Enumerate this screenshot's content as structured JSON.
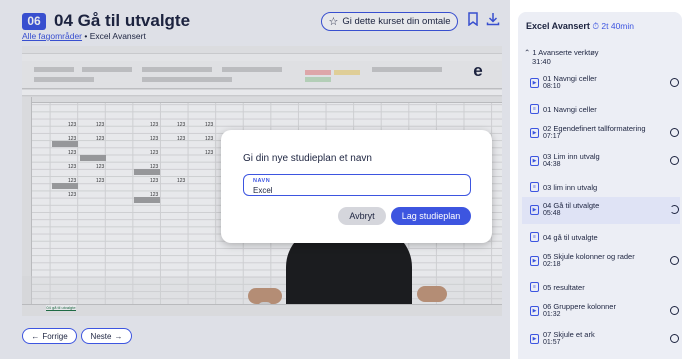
{
  "header": {
    "badge": "06",
    "title": "04 Gå til utvalgte",
    "breadcrumb": {
      "root": "Alle fagområder",
      "separator": "•",
      "current": "Excel Avansert"
    },
    "rate_label": "Gi dette kurset din omtale",
    "icons": [
      "star-icon",
      "bookmark-icon",
      "download-icon"
    ]
  },
  "video": {
    "logo_letter": "e",
    "sheet_tab": "04 gå til utvalgte",
    "cell_value": "123"
  },
  "modal": {
    "title": "Gi din nye studieplan et navn",
    "field_label": "NAVN",
    "field_value": "Excel",
    "cancel_label": "Avbryt",
    "create_label": "Lag studieplan"
  },
  "nav": {
    "prev_label": "Forrige",
    "next_label": "Neste"
  },
  "sidebar": {
    "course_title": "Excel Avansert",
    "total_time": "2t 40min",
    "section": {
      "title": "1 Avanserte verktøy",
      "duration": "31:40"
    },
    "items": [
      {
        "type": "video",
        "title": "01 Navngi celler",
        "duration": "08:10",
        "active": false
      },
      {
        "type": "doc",
        "title": "01 Navngi celler",
        "duration": "",
        "active": false
      },
      {
        "type": "video",
        "title": "02 Egendefinert tallformatering",
        "duration": "07:17",
        "active": false
      },
      {
        "type": "video",
        "title": "03 Lim inn utvalg",
        "duration": "04:38",
        "active": false
      },
      {
        "type": "doc",
        "title": "03 lim inn utvalg",
        "duration": "",
        "active": false
      },
      {
        "type": "video",
        "title": "04 Gå til utvalgte",
        "duration": "05:48",
        "active": true
      },
      {
        "type": "doc",
        "title": "04 gå til utvalgte",
        "duration": "",
        "active": false
      },
      {
        "type": "video",
        "title": "05 Skjule kolonner og rader",
        "duration": "02:18",
        "active": false
      },
      {
        "type": "doc",
        "title": "05 resultater",
        "duration": "",
        "active": false
      },
      {
        "type": "video",
        "title": "06 Gruppere kolonner",
        "duration": "01:32",
        "active": false
      },
      {
        "type": "video",
        "title": "07 Skjule et ark",
        "duration": "01:57",
        "active": false
      }
    ]
  },
  "colors": {
    "accent": "#3d55e0",
    "text": "#1d2440",
    "sidebar_bg": "#eceef5"
  }
}
